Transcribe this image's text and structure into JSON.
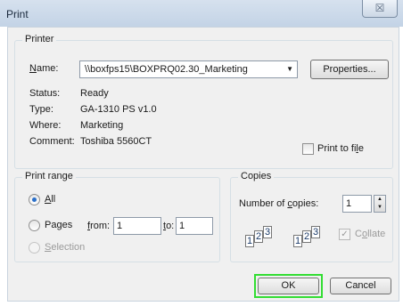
{
  "window": {
    "title": "Print",
    "close_glyph": "☒"
  },
  "printer": {
    "legend": "Printer",
    "name_label": "Name:",
    "name_value": "\\\\boxfps15\\BOXPRQ02.30_Marketing",
    "properties_label": "Properties...",
    "status_label": "Status:",
    "status_value": "Ready",
    "type_label": "Type:",
    "type_value": "GA-1310 PS v1.0",
    "where_label": "Where:",
    "where_value": "Marketing",
    "comment_label": "Comment:",
    "comment_value": "Toshiba 5560CT",
    "print_to_file_label": "Print to file",
    "print_to_file_checked": false
  },
  "print_range": {
    "legend": "Print range",
    "all_label": "All",
    "pages_label": "Pages",
    "from_label": "from:",
    "from_value": "1",
    "to_label": "to:",
    "to_value": "1",
    "selection_label": "Selection",
    "selected": "all"
  },
  "copies": {
    "legend": "Copies",
    "number_label": "Number of copies:",
    "number_value": "1",
    "collate_label": "Collate",
    "collate_checked": true,
    "collate_glyph": "✓",
    "page_digits": [
      "1",
      "2",
      "3"
    ],
    "spin_up_glyph": "▲",
    "spin_down_glyph": "▼"
  },
  "buttons": {
    "ok_label": "OK",
    "cancel_label": "Cancel"
  },
  "colors": {
    "ok_highlight": "#33dd33",
    "title_bar": "#c3d3e6"
  }
}
